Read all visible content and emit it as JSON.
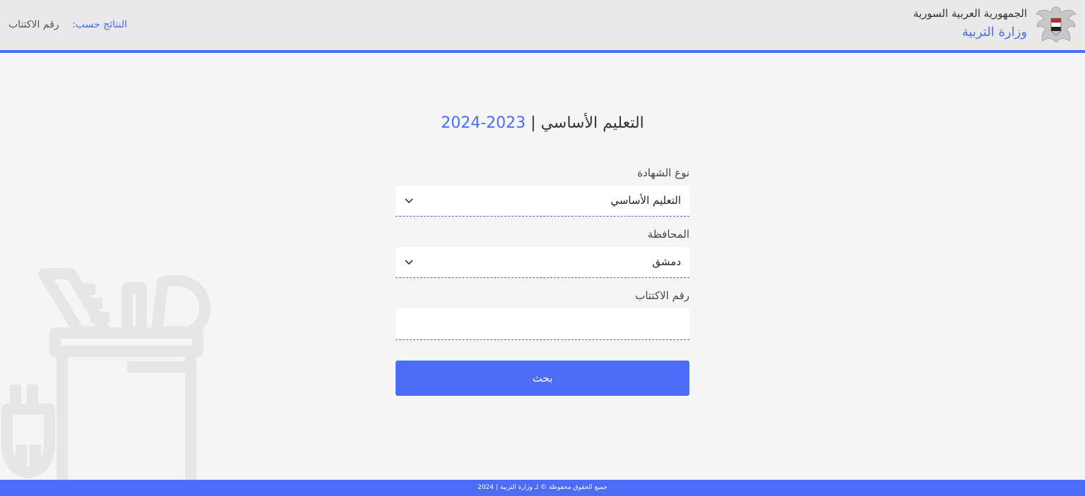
{
  "header": {
    "gov_name": "الجمهورية العربية السورية",
    "ministry": "وزارة التربية",
    "results_by_label": "النتائج حسب:",
    "results_by_value": "رقم الاكتتاب"
  },
  "main": {
    "title": "التعليم الأساسي",
    "separator": "|",
    "year": "2023-2024",
    "certificate_label": "نوع الشهادة",
    "certificate_value": "التعليم الأساسي",
    "governorate_label": "المحافظة",
    "governorate_value": "دمشق",
    "subscription_label": "رقم الاكتتاب",
    "subscription_value": "",
    "search_button": "بحث"
  },
  "footer": {
    "text": "جميع الحقوق محفوظة © لـ وزارة التربية | 2024"
  },
  "colors": {
    "accent": "#4a6cf7",
    "header_bg": "#e9e9e9",
    "page_bg": "#f5f5f5"
  },
  "icons": {
    "emblem": "syrian-eagle-emblem-icon",
    "chevron": "chevron-down-icon",
    "decoration": "pencil-cup-icon"
  }
}
